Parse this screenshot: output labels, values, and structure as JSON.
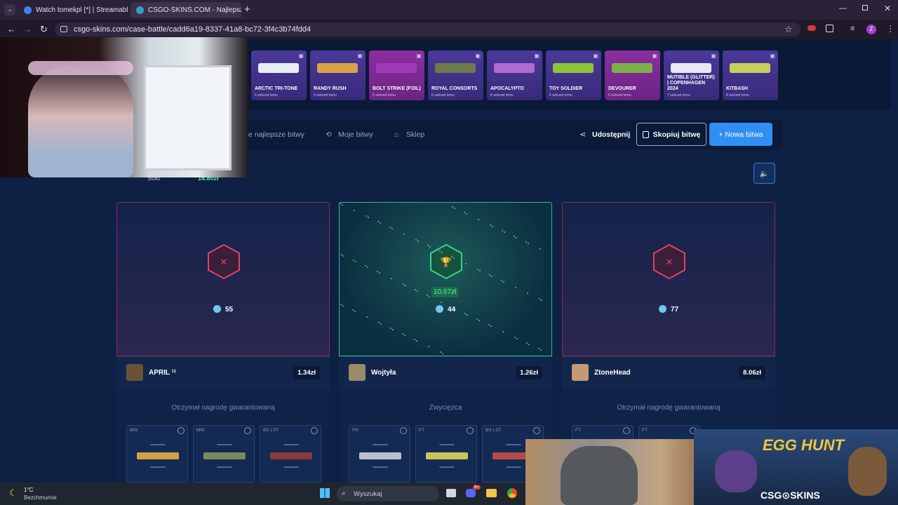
{
  "browser": {
    "tabs": [
      {
        "title": "Watch tomekpl [*] | Streamable",
        "close": "✕"
      },
      {
        "title": "CSGO-SKINS.COM - Najlepsze ...",
        "close": "✕"
      }
    ],
    "new_tab": "+",
    "url": "csgo-skins.com/case-battle/cadd6a19-8337-41a8-bc72-3f4c3b74fdd4",
    "profile_initial": "Z",
    "colors": {
      "frame": "#2a2238",
      "active_tab": "#3a324a"
    }
  },
  "cases": [
    {
      "name": "ARCTIC TRI-TONE",
      "time": "5 sekund temu",
      "gun_color": "#e8eef5",
      "style": "blue"
    },
    {
      "name": "RANDY RUSH",
      "time": "5 sekund temu",
      "gun_color": "#d9a34a",
      "style": "blue"
    },
    {
      "name": "BOLT STRIKE (FOIL)",
      "time": "5 sekund temu",
      "gun_color": "#a03bb8",
      "style": "pink"
    },
    {
      "name": "ROYAL CONSORTS",
      "time": "6 sekund temu",
      "gun_color": "#6d7a4a",
      "style": "blue"
    },
    {
      "name": "APOCALYPTO",
      "time": "6 sekund temu",
      "gun_color": "#b06ad0",
      "style": "blue"
    },
    {
      "name": "TOY SOLDIER",
      "time": "6 sekund temu",
      "gun_color": "#8bc43a",
      "style": "blue"
    },
    {
      "name": "DEVOURER",
      "time": "6 sekund temu",
      "gun_color": "#7fb04a",
      "style": "pink"
    },
    {
      "name": "MUTIBLE (GLITTER) | COPENHAGEN 2024",
      "time": "7 sekund temu",
      "gun_color": "#e8e8f0",
      "style": "blue"
    },
    {
      "name": "KITBASH",
      "time": "8 sekund temu",
      "gun_color": "#c6d05a",
      "style": "blue"
    }
  ],
  "menu": {
    "best_battles": "e najlepsze bitwy",
    "my_battles": "Moje bitwy",
    "shop": "Sklep",
    "share": "Udostępnij",
    "copy_battle": "Skopiuj bitwę",
    "new_battle": "+ Nowa bitwa"
  },
  "battle_info": {
    "mode": "Solo",
    "value": "16.80zł"
  },
  "players": [
    {
      "name": "APRIL ¹⁾",
      "value": "1.34zł",
      "coins": "55",
      "status": "Otrzymał nagrodę gwarantowaną",
      "winner": false,
      "avatar_color": "#6b5237",
      "items": [
        {
          "wear": "MW",
          "gun": "#d5a04a"
        },
        {
          "wear": "MW",
          "gun": "#7a8a5a"
        },
        {
          "wear": "BS | ST",
          "gun": "#8a3a3a"
        }
      ]
    },
    {
      "name": "Wojtyła",
      "value": "1.26zł",
      "coins": "44",
      "prize": "10.67zł",
      "status": "Zwycięzca",
      "winner": true,
      "avatar_color": "#9a8a6a",
      "items": [
        {
          "wear": "FN",
          "gun": "#b9c0cc"
        },
        {
          "wear": "FT",
          "gun": "#c9c45a"
        },
        {
          "wear": "BS | ST",
          "gun": "#b44b4b"
        }
      ]
    },
    {
      "name": "ZtoneHead",
      "value": "8.06zł",
      "coins": "77",
      "status": "Otrzymał nagrodę gwarantowaną",
      "winner": false,
      "avatar_color": "#c49a75",
      "items": [
        {
          "wear": "FT",
          "gun": "#5a6a8a"
        },
        {
          "wear": "FT",
          "gun": "#6a7a9a"
        }
      ]
    }
  ],
  "promo": {
    "title": "EGG HUNT",
    "brand": "CSG⊙SKINS"
  },
  "taskbar": {
    "temp": "1°C",
    "weather": "Bezchmurnie",
    "search": "Wyszukaj",
    "discord_badge": "9+"
  }
}
